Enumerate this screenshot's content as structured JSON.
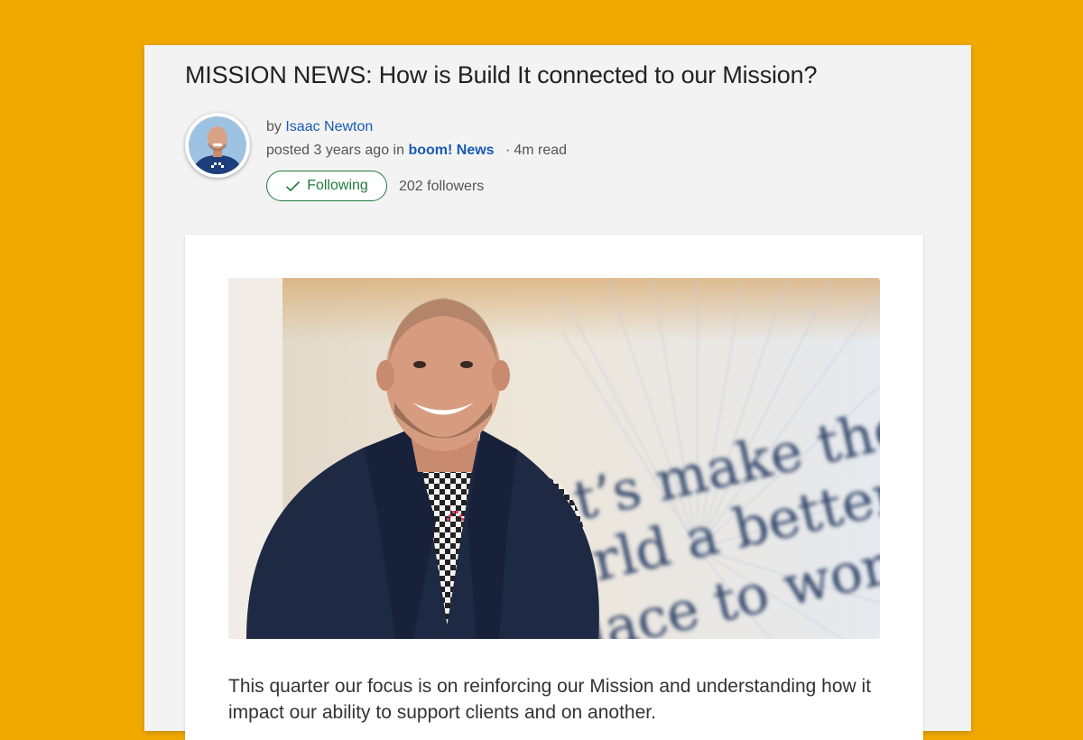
{
  "article": {
    "title": "MISSION NEWS: How is Build It connected to our Mission?",
    "by_prefix": "by",
    "author": "Isaac Newton",
    "posted_text": "posted 3 years ago in",
    "category": "boom! News",
    "separator": "·",
    "read_time": "4m read",
    "follow_label": "Following",
    "followers": "202 followers",
    "image_text_lines": [
      "et’s make the",
      "orld a better",
      "lace to work"
    ],
    "body": "This quarter our focus is on reinforcing our Mission and understanding how it impact our ability to support clients and on another."
  },
  "icons": {
    "follow": "check-icon",
    "avatar": "user-avatar",
    "hero": "author-photo"
  },
  "colors": {
    "background": "#f1a900",
    "link": "#1a5bb5",
    "follow_green": "#1e7a3b"
  }
}
